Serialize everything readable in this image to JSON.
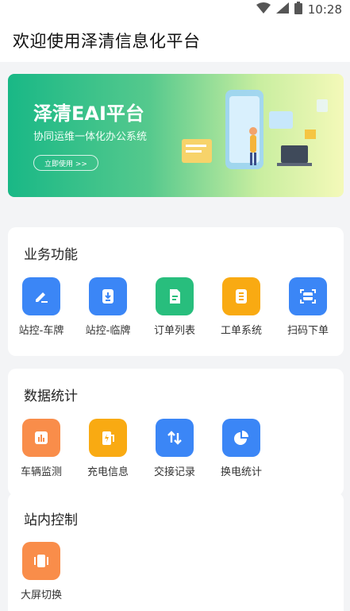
{
  "status_bar": {
    "time": "10:28"
  },
  "header": {
    "title": "欢迎使用泽清信息化平台"
  },
  "banner": {
    "title": "泽清EAI平台",
    "subtitle": "协同运维一体化办公系统",
    "button_label": "立即使用 >>"
  },
  "business": {
    "title": "业务功能",
    "items": [
      {
        "label": "站控-车牌",
        "icon": "pen-edit-icon",
        "color": "#3b86f6"
      },
      {
        "label": "站控-临牌",
        "icon": "download-doc-icon",
        "color": "#3b86f6"
      },
      {
        "label": "订单列表",
        "icon": "document-icon",
        "color": "#28be7d"
      },
      {
        "label": "工单系统",
        "icon": "list-doc-icon",
        "color": "#f9aa12"
      },
      {
        "label": "扫码下单",
        "icon": "scan-icon",
        "color": "#3b86f6"
      }
    ]
  },
  "stats": {
    "title": "数据统计",
    "items": [
      {
        "label": "车辆监测",
        "icon": "bar-chart-icon",
        "color": "#f98d4a"
      },
      {
        "label": "充电信息",
        "icon": "charging-station-icon",
        "color": "#f9aa12"
      },
      {
        "label": "交接记录",
        "icon": "exchange-icon",
        "color": "#3b86f6"
      },
      {
        "label": "换电统计",
        "icon": "pie-chart-icon",
        "color": "#3b86f6"
      }
    ]
  },
  "control": {
    "title": "站内控制",
    "items": [
      {
        "label": "大屏切换",
        "icon": "screen-switch-icon",
        "color": "#f98d4a"
      }
    ]
  }
}
